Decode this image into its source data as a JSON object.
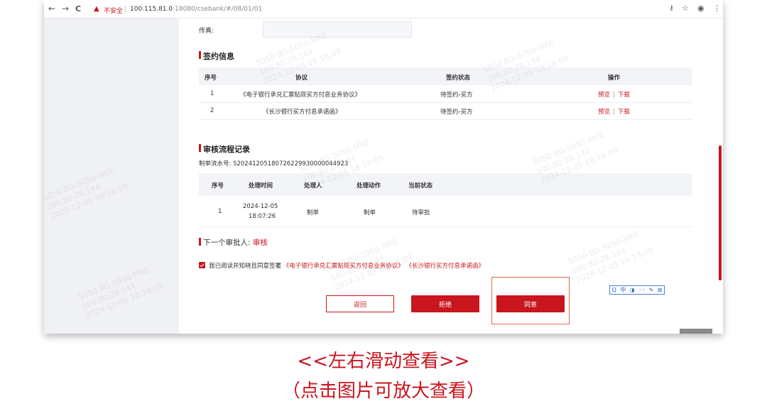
{
  "browser": {
    "back": "←",
    "forward": "→",
    "reload": "C",
    "security_label": "不安全",
    "url_host": "100.115.81.0",
    "url_path": ":18080/csebank/#/08/01/01",
    "key_icon": "key-icon",
    "star_icon": "star-icon",
    "account_icon": "account-icon",
    "menu_icon": "menu-icon"
  },
  "form": {
    "fax_label": "传真:"
  },
  "signing": {
    "title": "签约信息",
    "columns": [
      "序号",
      "协议",
      "签约状态",
      "操作"
    ],
    "rows": [
      {
        "index": "1",
        "agreement": "《电子银行承兑汇票贴现买方付息业务协议》",
        "status": "待签约-买方",
        "preview": "预览",
        "download": "下载"
      },
      {
        "index": "2",
        "agreement": "《长沙银行买方付息承诺函》",
        "status": "待签约-买方",
        "preview": "预览",
        "download": "下载"
      }
    ],
    "op_separator": "|"
  },
  "audit": {
    "title": "审核流程记录",
    "serial_label": "制单流水号:",
    "serial_value": "S20241205180726229930000044923",
    "columns": [
      "序号",
      "处理时间",
      "处理人",
      "处理动作",
      "当前状态"
    ],
    "rows": [
      {
        "index": "1",
        "date": "2024-12-05",
        "time": "18:07:26",
        "handler": "制单",
        "action": "制单",
        "status": "待审批"
      }
    ]
  },
  "next_approver": {
    "label": "下一个审批人:",
    "value": "审核"
  },
  "agreement_confirm": {
    "checked": true,
    "text": "我已阅读并知晓且同意签署",
    "doc1": "《电子银行承兑汇票贴现买方付息业务协议》",
    "doc2": "《长沙银行买方付息承诺函》"
  },
  "buttons": {
    "back": "返回",
    "reject": "拒绝",
    "approve": "同意"
  },
  "ime": {
    "items": [
      "Q",
      "中",
      "◑",
      "◦◦",
      "✎",
      "⊞"
    ]
  },
  "watermark": {
    "line1": "5050  BG-5050-MKE",
    "line2": "100.80.28.144",
    "line3": "2024-12-05 18:18:09"
  },
  "captions": {
    "swipe": "<<左右滑动查看>>",
    "zoom": "（点击图片可放大查看）"
  },
  "colors": {
    "accent": "#c9151e",
    "header_bg": "#f2f4f7",
    "sidebar_bg": "#f0f1f4"
  }
}
